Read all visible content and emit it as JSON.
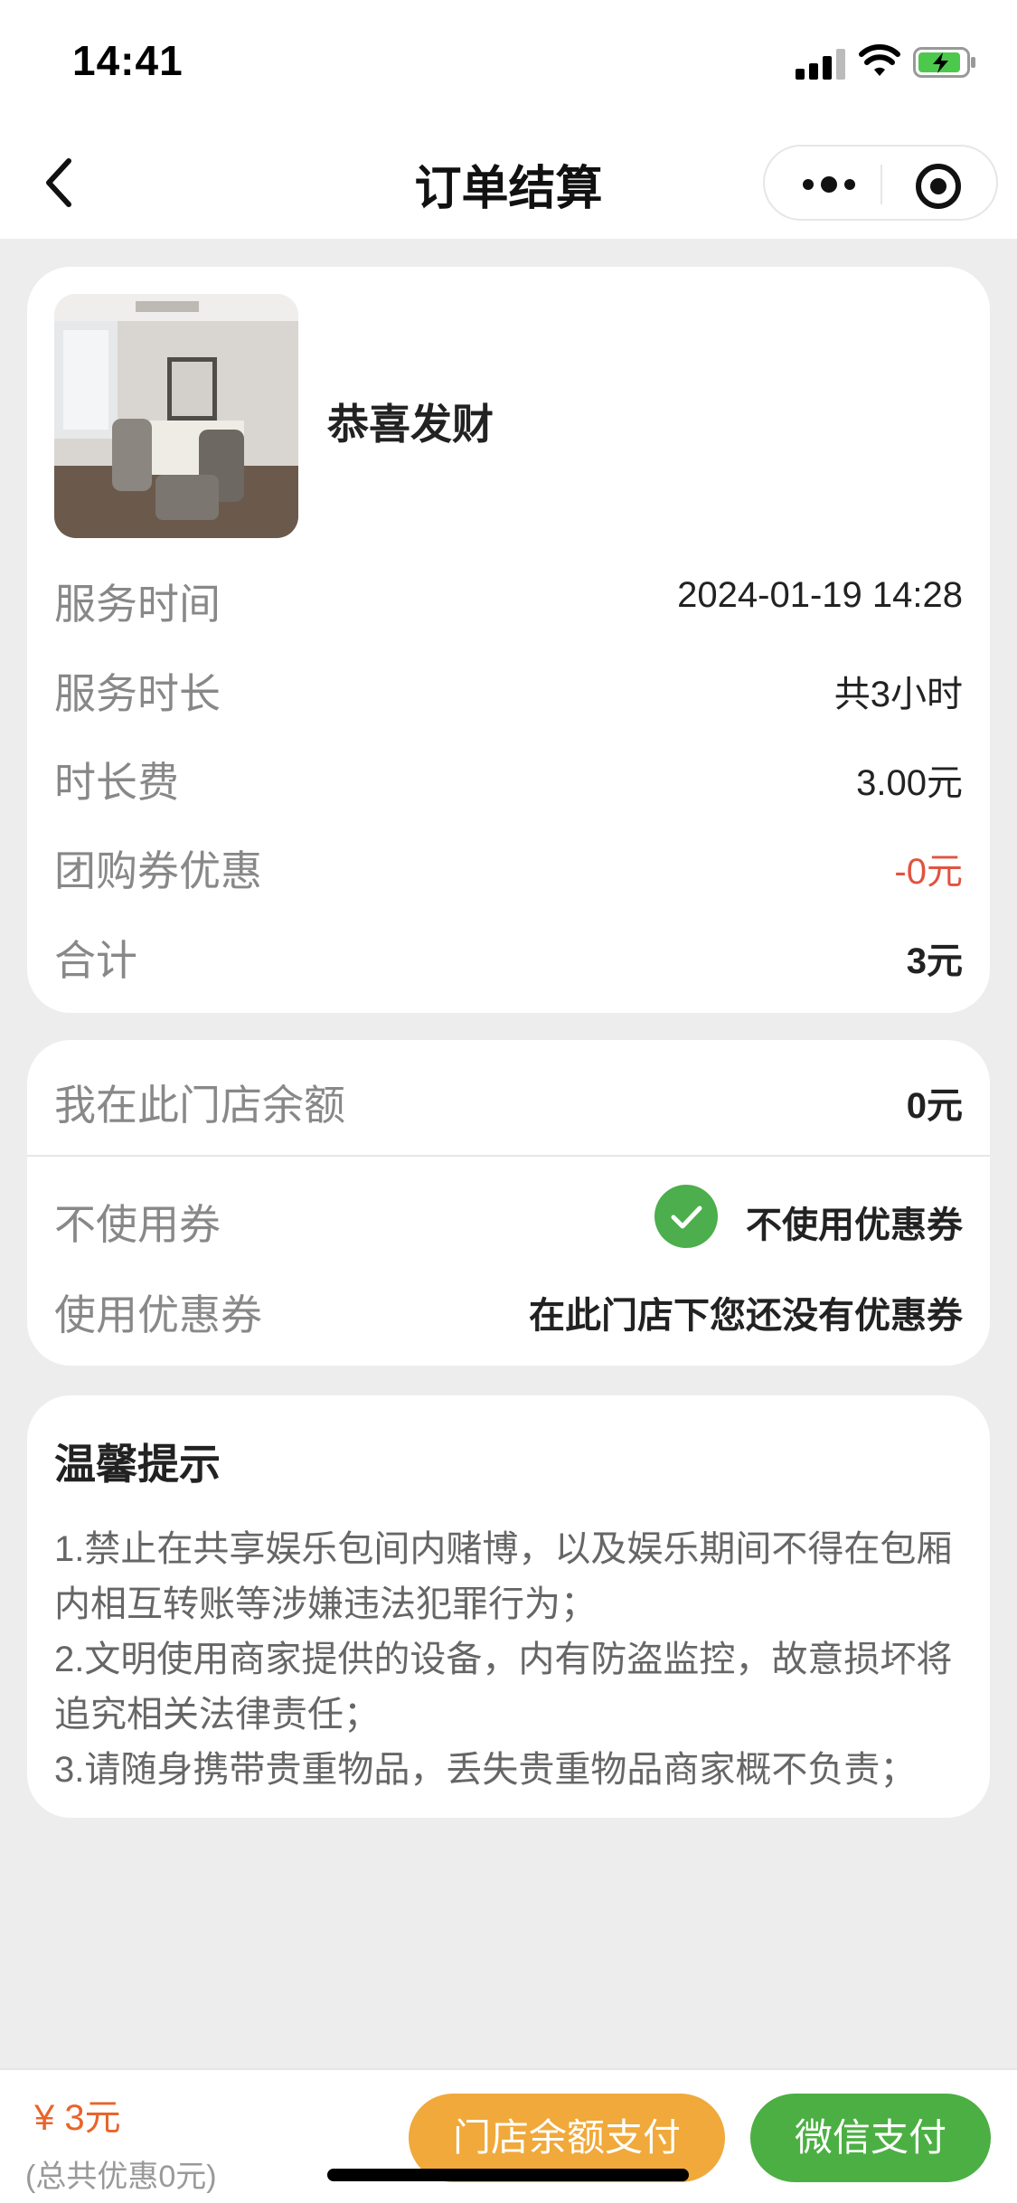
{
  "status_bar": {
    "time": "14:41",
    "icons": [
      "cellular-signal-icon",
      "wifi-icon",
      "battery-charging-icon"
    ]
  },
  "navbar": {
    "title": "订单结算",
    "icons": [
      "back-chevron-icon",
      "more-dots-icon",
      "target-circle-icon"
    ]
  },
  "order": {
    "room_name": "恭喜发财",
    "image_icon": "room-photo",
    "rows": [
      {
        "label": "服务时间",
        "value": "2024-01-19 14:28"
      },
      {
        "label": "服务时长",
        "value": "共3小时"
      },
      {
        "label": "时长费",
        "value": "3.00元"
      },
      {
        "label": "团购券优惠",
        "value": "-0元"
      },
      {
        "label": "合计",
        "value": "3元"
      }
    ]
  },
  "balance": {
    "label": "我在此门店余额",
    "value": "0元",
    "no_coupon_label": "不使用券",
    "no_coupon_value": "不使用优惠券",
    "use_coupon_label": "使用优惠券",
    "use_coupon_value": "在此门店下您还没有优惠券"
  },
  "tips": {
    "title": "温馨提示",
    "lines": [
      "1.禁止在共享娱乐包间内赌博，以及娱乐期间不得在包厢内相互转账等涉嫌违法犯罪行为；",
      "2.文明使用商家提供的设备，内有防盗监控，故意损坏将追究相关法律责任；",
      "3.请随身携带贵重物品，丢失贵重物品商家概不负责；"
    ]
  },
  "footer": {
    "price": "¥ 3元",
    "discount": "(总共优惠0元)",
    "store_pay": "门店余额支付",
    "wechat_pay": "微信支付"
  },
  "colors": {
    "accent_orange": "#e8642a",
    "button_orange": "#f0a93a",
    "button_green": "#4caf43",
    "check_green": "#4cae4c",
    "discount_red": "#e2533f",
    "background": "#ededed"
  }
}
